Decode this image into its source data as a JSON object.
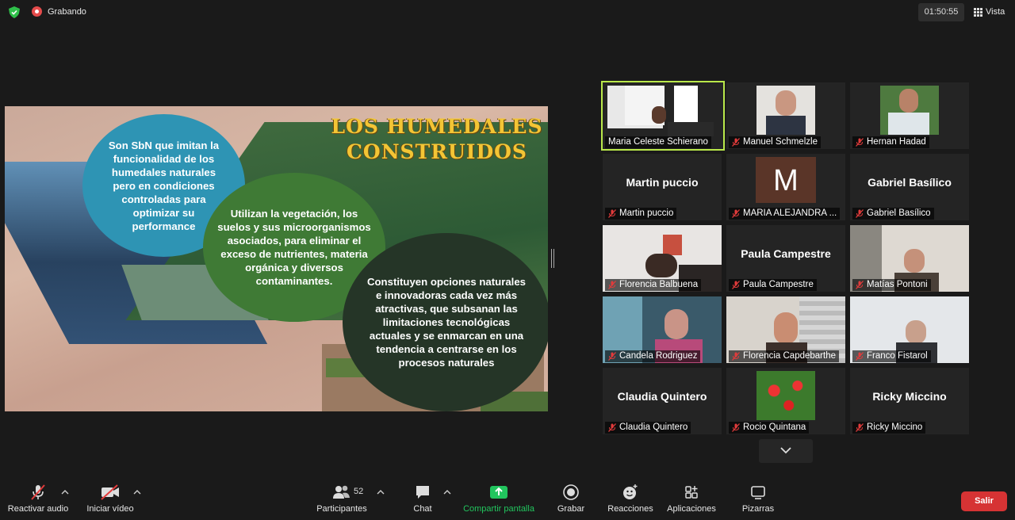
{
  "topbar": {
    "recording_label": "Grabando",
    "timer": "01:50:55",
    "view_label": "Vista"
  },
  "slide": {
    "title_line1": "LOS HUMEDALES",
    "title_line2": "CONSTRUIDOS",
    "circle1": "Son SbN que imitan la funcionalidad de los humedales naturales pero en condiciones controladas para optimizar su performance",
    "circle2": "Utilizan la vegetación, los suelos y sus microorganismos asociados, para eliminar el exceso de nutrientes, materia orgánica y diversos contaminantes.",
    "circle3": "Constituyen opciones naturales e innovadoras cada vez más atractivas, que subsanan las limitaciones tecnológicas actuales y se enmarcan en una tendencia a centrarse en los procesos naturales"
  },
  "participants": [
    {
      "name": "Maria Celeste Schierano",
      "big": "",
      "active": true
    },
    {
      "name": "Manuel Schmelzle",
      "big": ""
    },
    {
      "name": "Hernan Hadad",
      "big": ""
    },
    {
      "name": "Martin puccio",
      "big": "Martin puccio"
    },
    {
      "name": "MARIA ALEJANDRA ...",
      "big": "",
      "avatar": "M"
    },
    {
      "name": "Gabriel Basílico",
      "big": "Gabriel Basílico"
    },
    {
      "name": "Florencia Balbuena",
      "big": ""
    },
    {
      "name": "Paula Campestre",
      "big": "Paula Campestre"
    },
    {
      "name": "Matías Pontoni",
      "big": ""
    },
    {
      "name": "Candela Rodriguez",
      "big": ""
    },
    {
      "name": "Florencia Capdebarthe",
      "big": ""
    },
    {
      "name": "Franco Fistarol",
      "big": ""
    },
    {
      "name": "Claudia Quintero",
      "big": "Claudia Quintero"
    },
    {
      "name": "Rocio Quintana",
      "big": ""
    },
    {
      "name": "Ricky Miccino",
      "big": "Ricky Miccino"
    }
  ],
  "toolbar": {
    "unmute": "Reactivar audio",
    "start_video": "Iniciar vídeo",
    "participants": "Participantes",
    "participants_count": "52",
    "chat": "Chat",
    "share": "Compartir pantalla",
    "record": "Grabar",
    "reactions": "Reacciones",
    "apps": "Aplicaciones",
    "whiteboards": "Pizarras",
    "leave": "Salir"
  },
  "colors": {
    "active_border": "#b9e84a",
    "leave": "#d63334",
    "share_green": "#22c55e",
    "muted_red": "#e23b3b"
  }
}
